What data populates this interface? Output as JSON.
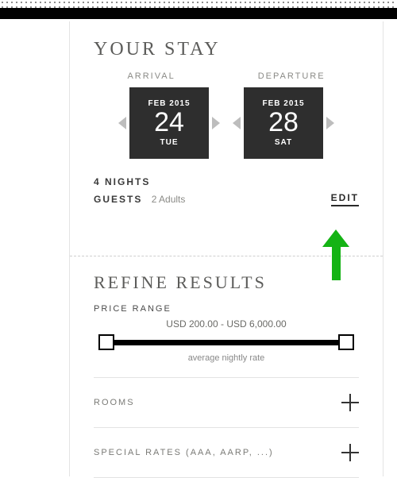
{
  "stay": {
    "title": "YOUR STAY",
    "arrival": {
      "label": "ARRIVAL",
      "month": "FEB 2015",
      "day": "24",
      "weekday": "TUE"
    },
    "departure": {
      "label": "DEPARTURE",
      "month": "FEB 2015",
      "day": "28",
      "weekday": "SAT"
    },
    "nights_text": "4 NIGHTS",
    "guests_label": "GUESTS",
    "guests_value": "2 Adults",
    "edit_label": "EDIT"
  },
  "refine": {
    "title": "REFINE RESULTS",
    "price": {
      "label": "PRICE RANGE",
      "range_text": "USD 200.00 - USD 6,000.00",
      "subtext": "average nightly rate",
      "min": 200.0,
      "max": 6000.0,
      "currency": "USD"
    },
    "accordion": [
      {
        "label": "ROOMS"
      },
      {
        "label": "SPECIAL RATES (AAA, AARP, ...)"
      }
    ]
  }
}
